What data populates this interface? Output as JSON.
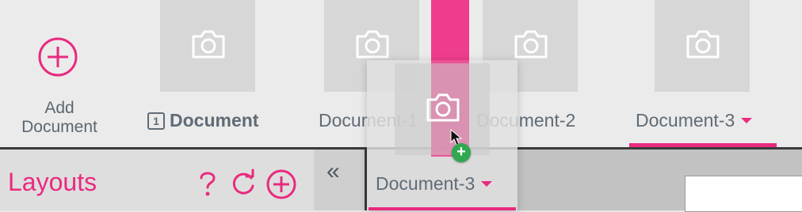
{
  "add_document": {
    "label_line1": "Add",
    "label_line2": "Document",
    "icon": "plus-circle-icon"
  },
  "documents": [
    {
      "label": "Document",
      "badge": "1",
      "icon": "camera-icon",
      "current": true
    },
    {
      "label": "Document-1",
      "icon": "camera-icon"
    },
    {
      "label": "Document-2",
      "icon": "camera-icon"
    },
    {
      "label": "Document-3",
      "icon": "camera-icon",
      "selected": true,
      "has_menu": true
    }
  ],
  "drag_preview": {
    "label": "Document-3",
    "icon": "camera-icon",
    "drop_badge": "+"
  },
  "sidebar": {
    "title": "Layouts",
    "tools": [
      {
        "icon": "help-icon"
      },
      {
        "icon": "refresh-icon"
      },
      {
        "icon": "add-icon"
      }
    ],
    "collapse_label": "«"
  },
  "colors": {
    "accent": "#e92a7f",
    "text": "#5f6b76",
    "drop_badge": "#2fa84f"
  }
}
